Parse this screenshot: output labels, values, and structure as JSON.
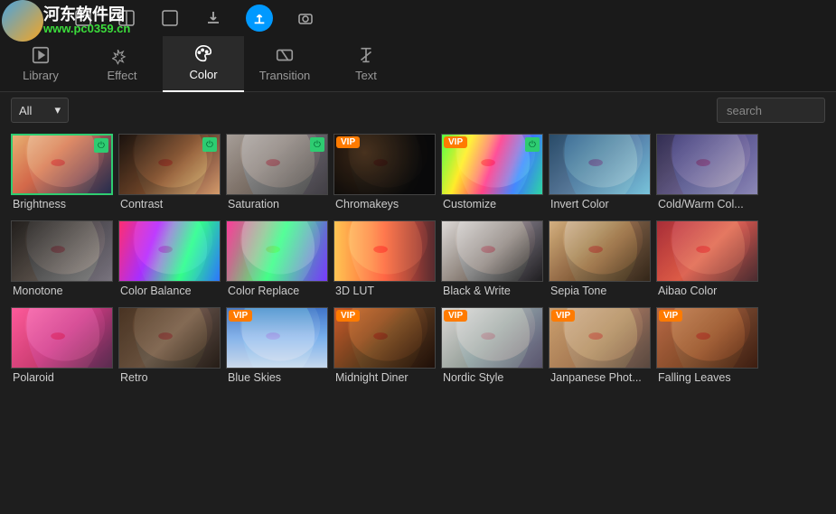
{
  "watermark": {
    "text": "河东软件园",
    "url": "www.pc0359.cn"
  },
  "toolbarIcons": [
    "window1",
    "window2",
    "window3",
    "download",
    "upload",
    "camera"
  ],
  "tabs": [
    {
      "label": "Library",
      "active": false
    },
    {
      "label": "Effect",
      "active": false
    },
    {
      "label": "Color",
      "active": true
    },
    {
      "label": "Transition",
      "active": false
    },
    {
      "label": "Text",
      "active": false
    }
  ],
  "filter": {
    "value": "All"
  },
  "search": {
    "placeholder": "search",
    "value": ""
  },
  "items": [
    {
      "label": "Brightness",
      "vip": false,
      "corner": true,
      "selected": true,
      "style": "brightness"
    },
    {
      "label": "Contrast",
      "vip": false,
      "corner": true,
      "selected": false,
      "style": "contrast"
    },
    {
      "label": "Saturation",
      "vip": false,
      "corner": true,
      "selected": false,
      "style": "saturation"
    },
    {
      "label": "Chromakeys",
      "vip": true,
      "corner": false,
      "selected": false,
      "style": "chroma"
    },
    {
      "label": "Customize",
      "vip": true,
      "corner": true,
      "selected": false,
      "style": "customize"
    },
    {
      "label": "Invert Color",
      "vip": false,
      "corner": false,
      "selected": false,
      "style": "invert"
    },
    {
      "label": "Cold/Warm Col...",
      "vip": false,
      "corner": false,
      "selected": false,
      "style": "coldwarm"
    },
    {
      "label": "Monotone",
      "vip": false,
      "corner": false,
      "selected": false,
      "style": "monotone"
    },
    {
      "label": "Color Balance",
      "vip": false,
      "corner": false,
      "selected": false,
      "style": "balance"
    },
    {
      "label": "Color Replace",
      "vip": false,
      "corner": false,
      "selected": false,
      "style": "replace"
    },
    {
      "label": "3D LUT",
      "vip": false,
      "corner": false,
      "selected": false,
      "style": "lut"
    },
    {
      "label": "Black & Write",
      "vip": false,
      "corner": false,
      "selected": false,
      "style": "bw"
    },
    {
      "label": "Sepia Tone",
      "vip": false,
      "corner": false,
      "selected": false,
      "style": "sepia"
    },
    {
      "label": "Aibao Color",
      "vip": false,
      "corner": false,
      "selected": false,
      "style": "aibao"
    },
    {
      "label": "Polaroid",
      "vip": false,
      "corner": false,
      "selected": false,
      "style": "polaroid"
    },
    {
      "label": "Retro",
      "vip": false,
      "corner": false,
      "selected": false,
      "style": "retro"
    },
    {
      "label": "Blue Skies",
      "vip": true,
      "corner": false,
      "selected": false,
      "style": "blueskies"
    },
    {
      "label": "Midnight Diner",
      "vip": true,
      "corner": false,
      "selected": false,
      "style": "midnight"
    },
    {
      "label": "Nordic Style",
      "vip": true,
      "corner": false,
      "selected": false,
      "style": "nordic"
    },
    {
      "label": "Janpanese Phot...",
      "vip": true,
      "corner": false,
      "selected": false,
      "style": "japanese"
    },
    {
      "label": "Falling Leaves",
      "vip": true,
      "corner": false,
      "selected": false,
      "style": "falling"
    }
  ],
  "badgeText": "VIP",
  "thumbStyles": {
    "brightness": "linear-gradient(135deg,#e8b88a 0%,#d4765a 40%,#2a3555 100%)",
    "contrast": "linear-gradient(135deg,#1a1410 0%,#6d4a2f 50%,#d9a974 100%)",
    "saturation": "linear-gradient(135deg,#a8a8a8 0%,#777 50%,#4a4a4a 100%)",
    "chroma": "radial-gradient(circle at 30% 30%,#3a2a1a 0%,#0a0a0a 70%)",
    "customize": "linear-gradient(110deg,#55ff55 0%,#ffee33 25%,#ff4488 50%,#4488ff 75%,#33ddaa 100%)",
    "invert": "linear-gradient(135deg,#2a5580 0%,#5a88aa 50%,#88ccdd 100%)",
    "coldwarm": "linear-gradient(135deg,#333366 0%,#666699 50%,#9999bb 100%)",
    "monotone": "linear-gradient(135deg,#222 0%,#555 50%,#888 100%)",
    "balance": "linear-gradient(110deg,#ff3388 0%,#aa33ff 33%,#33ff88 66%,#3388ff 100%)",
    "replace": "linear-gradient(110deg,#ff44aa 0%,#44ff88 50%,#8844ff 100%)",
    "lut": "linear-gradient(90deg,#ffcc66 0%,#ff6644 50%,#663333 100%)",
    "bw": "linear-gradient(135deg,#ddd 0%,#888 50%,#222 100%)",
    "sepia": "linear-gradient(135deg,#d4b896 0%,#8a6d4a 50%,#3a2d1a 100%)",
    "aibao": "linear-gradient(135deg,#aa3344 0%,#dd6655 50%,#553333 100%)",
    "polaroid": "linear-gradient(135deg,#ff66aa 0%,#cc4488 50%,#663355 100%)",
    "retro": "linear-gradient(135deg,#4a3a2a 0%,#6a5a4a 50%,#2a2218 100%)",
    "blueskies": "linear-gradient(180deg,#4a88cc 0%,#88bbee 50%,#ccddee 100%)",
    "midnight": "linear-gradient(135deg,#cc6633 0%,#664422 50%,#221108 100%)",
    "nordic": "linear-gradient(135deg,#ddd 0%,#9aa 50%,#667 100%)",
    "japanese": "linear-gradient(135deg,#ccaa88 0%,#aa8866 50%,#665544 100%)",
    "falling": "linear-gradient(135deg,#bb7755 0%,#885533 50%,#442211 100%)"
  }
}
